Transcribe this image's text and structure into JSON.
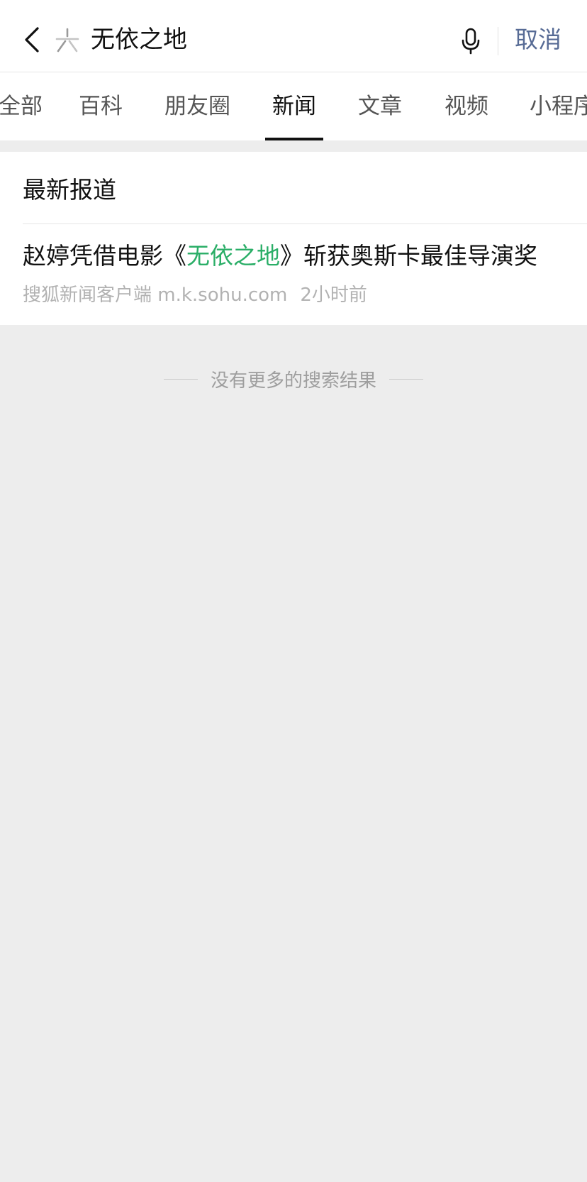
{
  "search": {
    "query": "无依之地",
    "cancel_label": "取消",
    "back_icon": "chevron-left-icon",
    "logo_icon": "search-app-logo-icon",
    "mic_icon": "microphone-icon"
  },
  "tabs": [
    {
      "label": "全部",
      "active": false
    },
    {
      "label": "百科",
      "active": false
    },
    {
      "label": "朋友圈",
      "active": false
    },
    {
      "label": "新闻",
      "active": true
    },
    {
      "label": "文章",
      "active": false
    },
    {
      "label": "视频",
      "active": false
    },
    {
      "label": "小程序",
      "active": false
    }
  ],
  "section": {
    "title": "最新报道"
  },
  "news": [
    {
      "title_prefix": "赵婷凭借电影《",
      "title_highlight": "无依之地",
      "title_suffix": "》斩获奥斯卡最佳导演奖",
      "source": "搜狐新闻客户端 m.k.sohu.com",
      "time": "2小时前"
    }
  ],
  "footer": {
    "end_text": "没有更多的搜索结果"
  },
  "colors": {
    "accent_link": "#576b95",
    "highlight": "#2aae67",
    "page_bg": "#ededed",
    "meta_text": "#b2b2b2"
  }
}
